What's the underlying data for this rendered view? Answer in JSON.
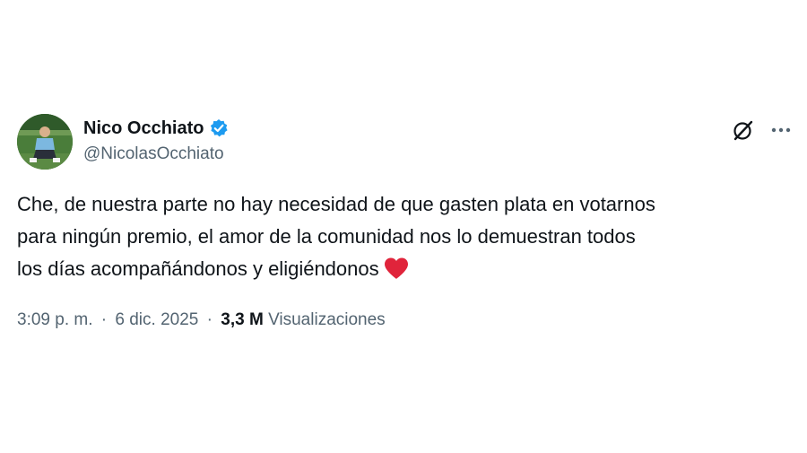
{
  "author": {
    "display_name": "Nico Occhiato",
    "handle": "@NicolasOcchiato",
    "verified": true
  },
  "tweet": {
    "lines": [
      "Che, de nuestra parte no hay necesidad de que gasten plata en votarnos",
      "para ningún premio, el amor de la comunidad nos lo demuestran todos",
      "los días acompañándonos y eligiéndonos"
    ],
    "emoji": "red-heart"
  },
  "meta": {
    "time": "3:09 p. m.",
    "separator": "·",
    "date": "6 dic. 2025",
    "views_count": "3,3 M",
    "views_label": "Visualizaciones"
  },
  "icons": {
    "verified": "verified-badge-icon",
    "grok": "grok-icon",
    "more": "more-options-icon"
  },
  "colors": {
    "text_primary": "#0f1419",
    "text_secondary": "#536471",
    "verified_blue": "#1d9bf0",
    "heart_red": "#e0243b"
  }
}
